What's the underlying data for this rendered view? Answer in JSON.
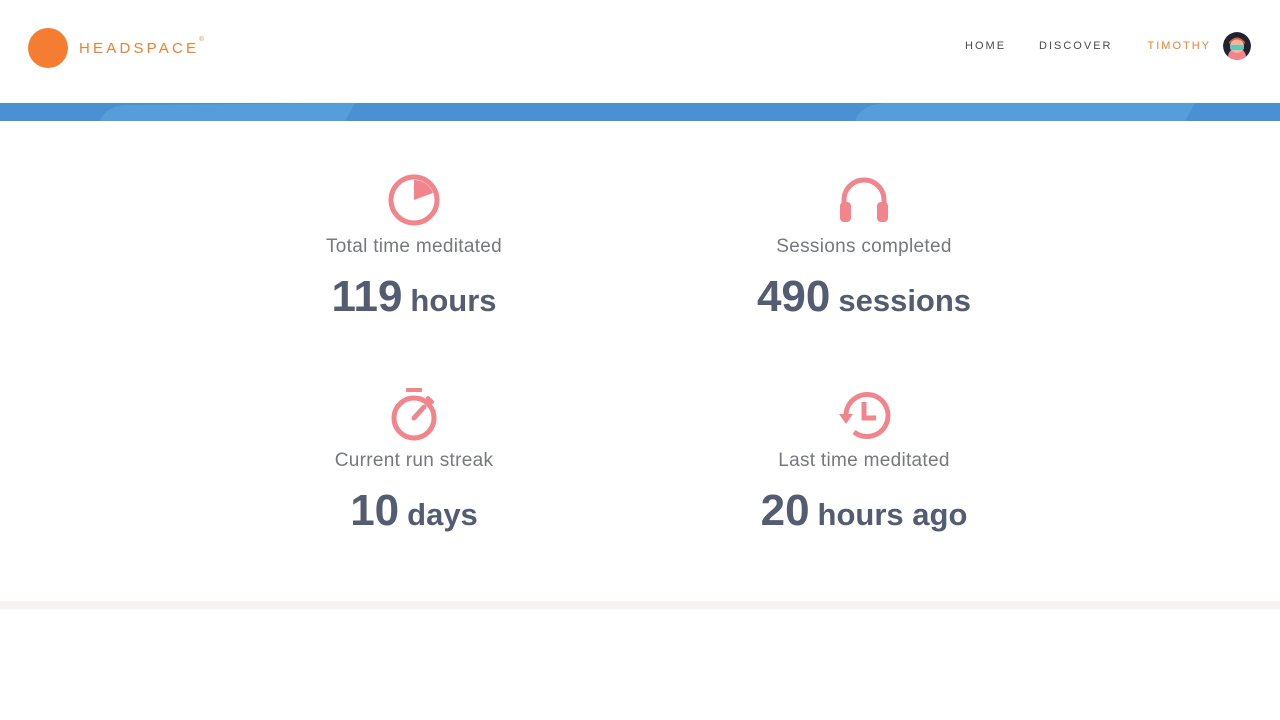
{
  "brand": {
    "name": "HEADSPACE",
    "registered": "®",
    "color": "#f47d31"
  },
  "nav": {
    "home": "HOME",
    "discover": "DISCOVER",
    "user": "TIMOTHY"
  },
  "colors": {
    "banner": "#4a90d2",
    "icon": "#f2848b",
    "value": "#545c72",
    "label": "#75787d"
  },
  "stats": [
    {
      "icon": "pie-chart-icon",
      "label": "Total time meditated",
      "number": "119",
      "unit": "hours"
    },
    {
      "icon": "headphones-icon",
      "label": "Sessions completed",
      "number": "490",
      "unit": "sessions"
    },
    {
      "icon": "stopwatch-icon",
      "label": "Current run streak",
      "number": "10",
      "unit": "days"
    },
    {
      "icon": "history-clock-icon",
      "label": "Last time meditated",
      "number": "20",
      "unit": "hours ago"
    }
  ]
}
